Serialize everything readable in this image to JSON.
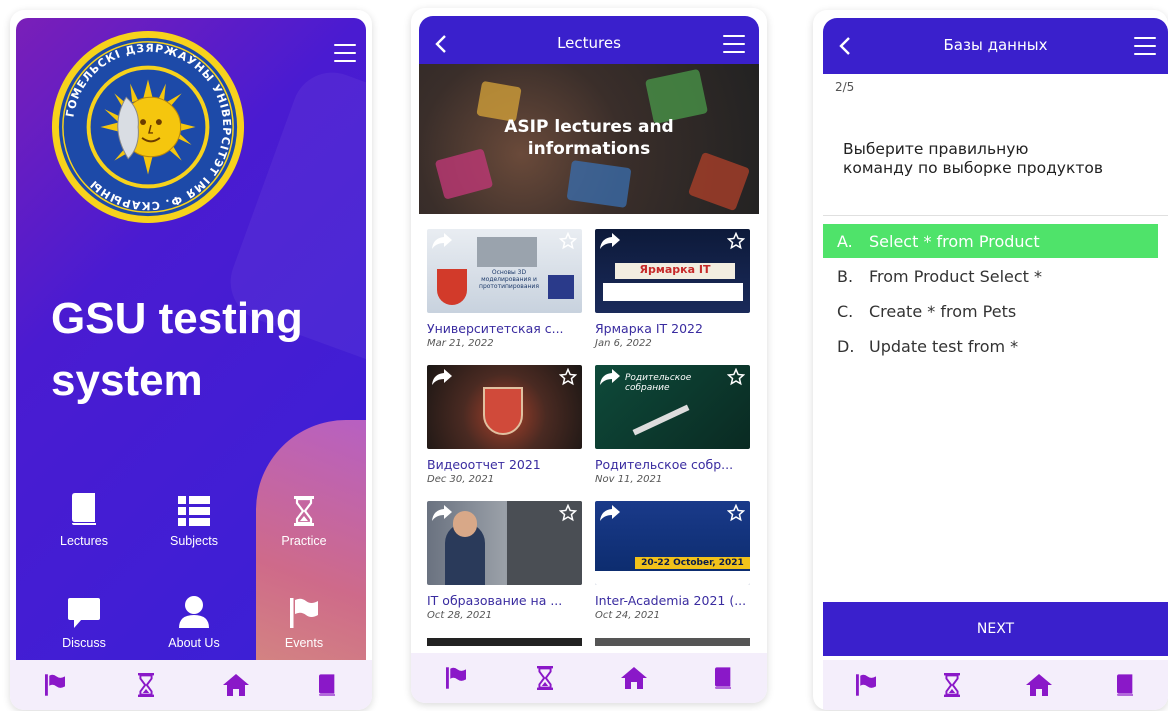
{
  "home": {
    "app_title": "GSU testing system",
    "grid": [
      {
        "label": "Lectures",
        "icon": "book-icon"
      },
      {
        "label": "Subjects",
        "icon": "list-icon"
      },
      {
        "label": "Practice",
        "icon": "hourglass-icon"
      },
      {
        "label": "Discuss",
        "icon": "chat-icon"
      },
      {
        "label": "About Us",
        "icon": "user-icon"
      },
      {
        "label": "Events",
        "icon": "flag-icon"
      }
    ],
    "seal_text": "ГОМЕЛЬСКІ ДЗЯРЖАЎНЫ УНІВЕРСІТЭТ ІМЯ Ф. СКАРЫНЫ"
  },
  "bottom_nav": [
    {
      "icon": "flag-icon"
    },
    {
      "icon": "hourglass-icon"
    },
    {
      "icon": "home-icon"
    },
    {
      "icon": "book-icon"
    }
  ],
  "lectures": {
    "header_title": "Lectures",
    "banner_text": "ASIP lectures and informations",
    "cards": [
      {
        "title": "Университетская с...",
        "date": "Mar 21, 2022",
        "thumb_text": "Основы 3D моделирования и прототипирования"
      },
      {
        "title": "Ярмарка IT 2022",
        "date": "Jan 6, 2022",
        "thumb_text": "Ярмарка IT"
      },
      {
        "title": "Видеоотчет 2021",
        "date": "Dec 30, 2021",
        "thumb_text": ""
      },
      {
        "title": "Родительское собр...",
        "date": "Nov 11, 2021",
        "thumb_text": "Родительское собрание"
      },
      {
        "title": "IT образование на ...",
        "date": "Oct 28, 2021",
        "thumb_text": ""
      },
      {
        "title": "Inter-Academia 2021 (...",
        "date": "Oct 24, 2021",
        "thumb_text": "20-22 October, 2021"
      }
    ]
  },
  "quiz": {
    "header_title": "Базы данных",
    "counter": "2/5",
    "question": "Выберите правильную команду по выборке продуктов",
    "options": [
      {
        "letter": "A.",
        "text": "Select * from Product",
        "correct": true
      },
      {
        "letter": "B.",
        "text": "From Product Select *",
        "correct": false
      },
      {
        "letter": "C.",
        "text": "Create * from Pets",
        "correct": false
      },
      {
        "letter": "D.",
        "text": "Update test from *",
        "correct": false
      }
    ],
    "next_label": "NEXT"
  },
  "colors": {
    "primary": "#3a20cc",
    "accent_icon": "#8a18c8",
    "correct": "#4fe36a"
  }
}
